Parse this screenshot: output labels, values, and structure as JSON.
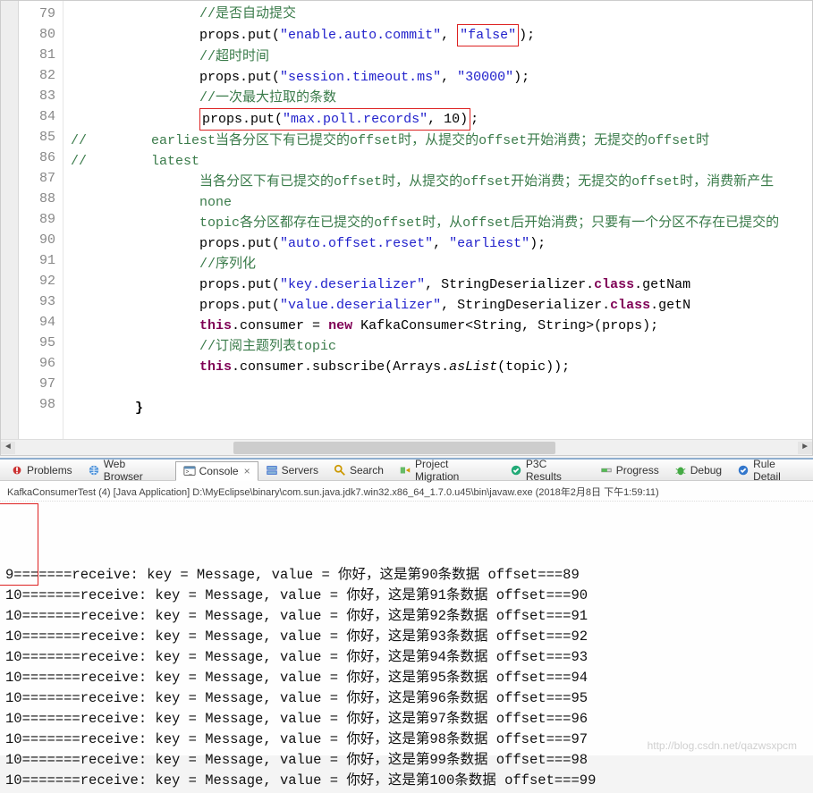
{
  "editor": {
    "lines": [
      {
        "n": 79,
        "indent": 16,
        "tokens": [
          {
            "t": "//是否自动提交",
            "c": "cm"
          }
        ]
      },
      {
        "n": 80,
        "indent": 16,
        "tokens": [
          {
            "t": "props.put(",
            "c": "pl"
          },
          {
            "t": "\"enable.auto.commit\"",
            "c": "str"
          },
          {
            "t": ", ",
            "c": "pl"
          },
          {
            "t": "\"false\"",
            "c": "str",
            "box": true
          },
          {
            "t": ");",
            "c": "pl"
          }
        ]
      },
      {
        "n": 81,
        "indent": 16,
        "tokens": [
          {
            "t": "//超时时间",
            "c": "cm"
          }
        ]
      },
      {
        "n": 82,
        "indent": 16,
        "tokens": [
          {
            "t": "props.put(",
            "c": "pl"
          },
          {
            "t": "\"session.timeout.ms\"",
            "c": "str"
          },
          {
            "t": ", ",
            "c": "pl"
          },
          {
            "t": "\"30000\"",
            "c": "str"
          },
          {
            "t": ");",
            "c": "pl"
          }
        ]
      },
      {
        "n": 83,
        "indent": 16,
        "tokens": [
          {
            "t": "//一次最大拉取的条数",
            "c": "cm"
          }
        ]
      },
      {
        "n": 84,
        "indent": 16,
        "boxline": true,
        "tokens": [
          {
            "t": "props.put(",
            "c": "pl"
          },
          {
            "t": "\"max.poll.records\"",
            "c": "str"
          },
          {
            "t": ", 10)",
            "c": "pl"
          },
          {
            "t": ";",
            "c": "pl",
            "outside": true
          }
        ]
      },
      {
        "n": 85,
        "indent": 0,
        "tokens": [
          {
            "t": "//        ",
            "c": "cm"
          },
          {
            "t": "earliest",
            "c": "cm"
          },
          {
            "t": "当各分区下有已提交的",
            "c": "cm"
          },
          {
            "t": "offset",
            "c": "cm"
          },
          {
            "t": "时，从提交的",
            "c": "cm"
          },
          {
            "t": "offset",
            "c": "cm"
          },
          {
            "t": "开始消费；无提交的",
            "c": "cm"
          },
          {
            "t": "offset",
            "c": "cm"
          },
          {
            "t": "时",
            "c": "cm"
          }
        ]
      },
      {
        "n": 86,
        "indent": 0,
        "tokens": [
          {
            "t": "//        ",
            "c": "cm"
          },
          {
            "t": "latest",
            "c": "cm"
          }
        ]
      },
      {
        "n": 87,
        "indent": 16,
        "tokens": [
          {
            "t": "当各分区下有已提交的",
            "c": "cm"
          },
          {
            "t": "offset",
            "c": "cm"
          },
          {
            "t": "时，从提交的",
            "c": "cm"
          },
          {
            "t": "offset",
            "c": "cm"
          },
          {
            "t": "开始消费；无提交的",
            "c": "cm"
          },
          {
            "t": "offset",
            "c": "cm"
          },
          {
            "t": "时，消费新产生",
            "c": "cm"
          }
        ]
      },
      {
        "n": 88,
        "indent": 16,
        "tokens": [
          {
            "t": "none",
            "c": "cm"
          }
        ]
      },
      {
        "n": 89,
        "indent": 16,
        "tokens": [
          {
            "t": "topic",
            "c": "cm"
          },
          {
            "t": "各分区都存在已提交的",
            "c": "cm"
          },
          {
            "t": "offset",
            "c": "cm"
          },
          {
            "t": "时，从",
            "c": "cm"
          },
          {
            "t": "offset",
            "c": "cm"
          },
          {
            "t": "后开始消费；只要有一个分区不存在已提交的",
            "c": "cm"
          }
        ]
      },
      {
        "n": 90,
        "indent": 16,
        "tokens": [
          {
            "t": "props.put(",
            "c": "pl"
          },
          {
            "t": "\"auto.offset.reset\"",
            "c": "str"
          },
          {
            "t": ", ",
            "c": "pl"
          },
          {
            "t": "\"earliest\"",
            "c": "str"
          },
          {
            "t": ");",
            "c": "pl"
          }
        ]
      },
      {
        "n": 91,
        "indent": 16,
        "tokens": [
          {
            "t": "//序列化",
            "c": "cm"
          }
        ]
      },
      {
        "n": 92,
        "indent": 16,
        "tokens": [
          {
            "t": "props.put(",
            "c": "pl"
          },
          {
            "t": "\"key.deserializer\"",
            "c": "str"
          },
          {
            "t": ", StringDeserializer.",
            "c": "pl"
          },
          {
            "t": "class",
            "c": "kw"
          },
          {
            "t": ".getNam",
            "c": "pl"
          }
        ]
      },
      {
        "n": 93,
        "indent": 16,
        "tokens": [
          {
            "t": "props.put(",
            "c": "pl"
          },
          {
            "t": "\"value.deserializer\"",
            "c": "str"
          },
          {
            "t": ", StringDeserializer.",
            "c": "pl"
          },
          {
            "t": "class",
            "c": "kw"
          },
          {
            "t": ".getN",
            "c": "pl"
          }
        ]
      },
      {
        "n": 94,
        "indent": 16,
        "tokens": [
          {
            "t": "this",
            "c": "kw"
          },
          {
            "t": ".consumer = ",
            "c": "pl"
          },
          {
            "t": "new",
            "c": "kw"
          },
          {
            "t": " KafkaConsumer<String, String>(props);",
            "c": "pl"
          }
        ]
      },
      {
        "n": 95,
        "indent": 16,
        "tokens": [
          {
            "t": "//订阅主题列表",
            "c": "cm"
          },
          {
            "t": "topic",
            "c": "cm"
          }
        ]
      },
      {
        "n": 96,
        "indent": 16,
        "tokens": [
          {
            "t": "this",
            "c": "kw"
          },
          {
            "t": ".consumer.subscribe(Arrays.",
            "c": "pl"
          },
          {
            "t": "asList",
            "c": "pl it"
          },
          {
            "t": "(topic));",
            "c": "pl"
          }
        ]
      },
      {
        "n": 97,
        "indent": 16,
        "tokens": []
      },
      {
        "n": 98,
        "indent": 8,
        "tokens": [
          {
            "t": "}",
            "c": "br"
          }
        ]
      }
    ]
  },
  "tabs": {
    "problems": "Problems",
    "webbrowser": "Web Browser",
    "console": "Console",
    "servers": "Servers",
    "search": "Search",
    "projectmigration": "Project Migration",
    "p3c": "P3C Results",
    "progress": "Progress",
    "debug": "Debug",
    "ruledetail": "Rule Detail"
  },
  "launch": "KafkaConsumerTest (4) [Java Application] D:\\MyEclipse\\binary\\com.sun.java.jdk7.win32.x86_64_1.7.0.u45\\bin\\javaw.exe (2018年2月8日 下午1:59:11)",
  "console_lines": [
    "9=======receive: key = Message, value = 你好，这是第90条数据 offset===89",
    "10=======receive: key = Message, value = 你好，这是第91条数据 offset===90",
    "10=======receive: key = Message, value = 你好，这是第92条数据 offset===91",
    "10=======receive: key = Message, value = 你好，这是第93条数据 offset===92",
    "10=======receive: key = Message, value = 你好，这是第94条数据 offset===93",
    "10=======receive: key = Message, value = 你好，这是第95条数据 offset===94",
    "10=======receive: key = Message, value = 你好，这是第96条数据 offset===95",
    "10=======receive: key = Message, value = 你好，这是第97条数据 offset===96",
    "10=======receive: key = Message, value = 你好，这是第98条数据 offset===97",
    "10=======receive: key = Message, value = 你好，这是第99条数据 offset===98",
    "10=======receive: key = Message, value = 你好，这是第100条数据 offset===99"
  ],
  "watermark": "http://blog.csdn.net/qazwsxpcm"
}
